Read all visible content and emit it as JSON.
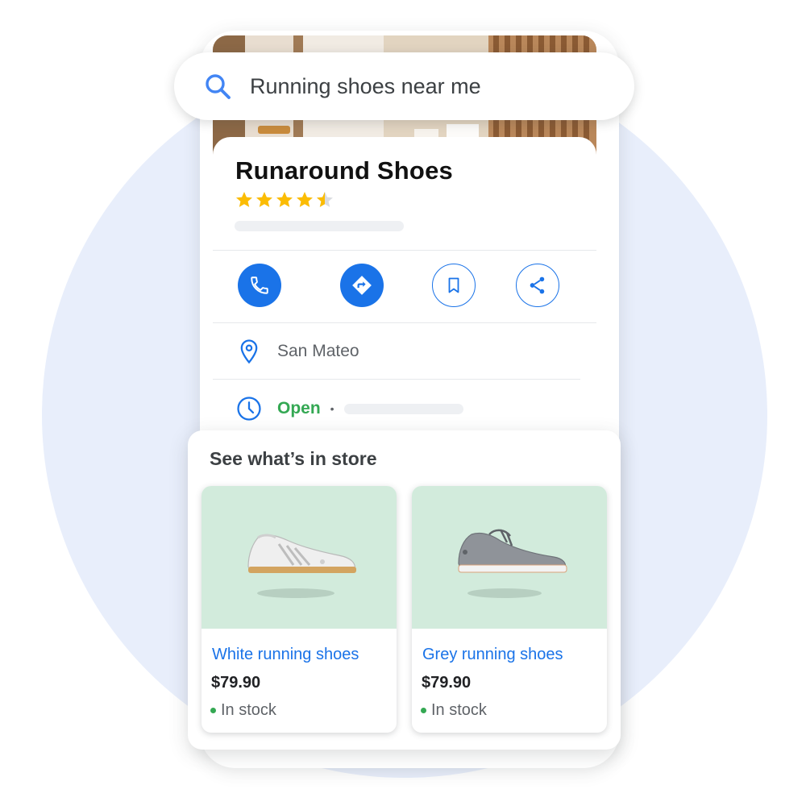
{
  "search": {
    "query": "Running shoes near me"
  },
  "place": {
    "name": "Runaround Shoes",
    "rating": 4.5,
    "rating_max": 5,
    "location": "San Mateo",
    "hours_status": "Open",
    "hours_separator": "•"
  },
  "actions": [
    {
      "name": "call",
      "icon": "phone-icon"
    },
    {
      "name": "directions",
      "icon": "directions-icon"
    },
    {
      "name": "save",
      "icon": "bookmark-icon"
    },
    {
      "name": "share",
      "icon": "share-icon"
    }
  ],
  "store": {
    "heading": "See what’s in store",
    "products": [
      {
        "name": "White running shoes",
        "price": "$79.90",
        "stock": "In stock"
      },
      {
        "name": "Grey running shoes",
        "price": "$79.90",
        "stock": "In stock"
      }
    ]
  },
  "colors": {
    "accent": "#1a73e8",
    "open_green": "#34a853",
    "star_gold": "#fbbc04",
    "background_circle": "#e8eefb",
    "product_background": "#d2ebdc"
  }
}
